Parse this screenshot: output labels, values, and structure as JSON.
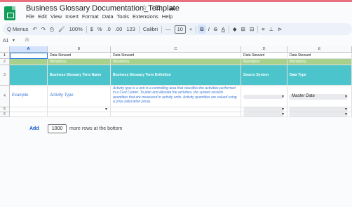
{
  "app": {
    "title": "Business Glossary Documentation_Template",
    "title_icons": "☆ ⊡ ☁",
    "menu": [
      "File",
      "Edit",
      "View",
      "Insert",
      "Format",
      "Data",
      "Tools",
      "Extensions",
      "Help"
    ]
  },
  "toolbar": {
    "menus": "Q Menus",
    "undo": "↶",
    "redo": "↷",
    "print": "⎙",
    "paint_format": "🖌",
    "zoom": "100%",
    "currency": "$",
    "percent": "%",
    "dec_less": ".0",
    "dec_more": ".00",
    "number_format": "123",
    "font": "Calibri",
    "font_minus": "—",
    "font_size": "10",
    "font_plus": "+",
    "bold": "B",
    "italic": "I",
    "strikethrough": "S",
    "text_color": "A",
    "fill": "◆",
    "borders": "⊞",
    "merge": "⊟",
    "align": "≡",
    "valign": "⊥",
    "rotate": "⊳"
  },
  "namebox": {
    "cell": "A1",
    "fx": "fx"
  },
  "columns": [
    "A",
    "B",
    "C",
    "D",
    "E"
  ],
  "rows": [
    "1",
    "2",
    "3",
    "4",
    "5",
    "6"
  ],
  "cells": {
    "r1": [
      "",
      "Data Steward",
      "Data Steward",
      "Data Steward",
      "Data Steward"
    ],
    "r2": [
      "",
      "Mandatory",
      "Mandatory",
      "Mandatory",
      "Mandatory"
    ],
    "r3": [
      "",
      "Business Glossary Term Name",
      "Business Glossary Term Definition",
      "Source System",
      "Data Type"
    ],
    "r4": [
      "Example",
      "Activity Type",
      "Activity type is a unit in a controlling area that classifies the activities performed in a Cost Center. To plan and allocate the activities, the system records quantities that are measured in activity units. Activity quantities are valued using a price (allocation price).",
      "",
      "Master Data"
    ]
  },
  "footer": {
    "add_label": "Add",
    "rows_value": "1000",
    "rows_suffix": "more rows at the bottom"
  },
  "colors": {
    "mandatory_row": "#a8d08d",
    "header_row": "#4bc4cb",
    "example_text": "#3c78d8",
    "accent": "#0b57d0"
  }
}
